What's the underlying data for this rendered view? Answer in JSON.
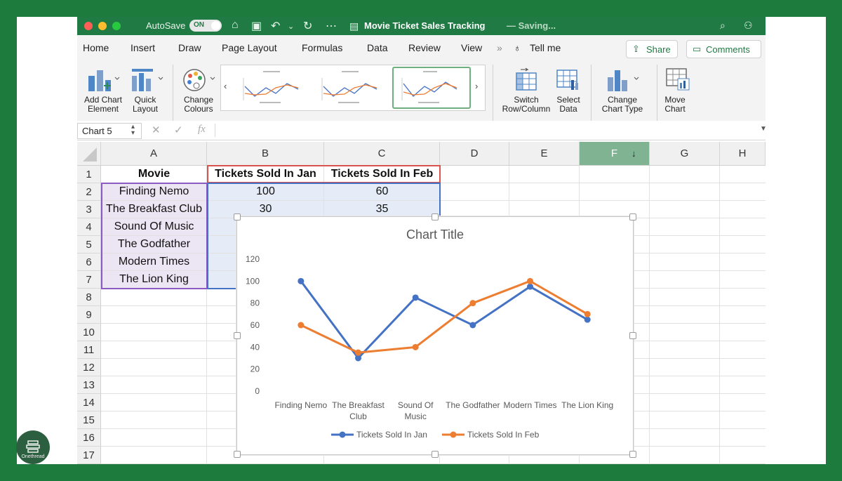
{
  "window": {
    "autosave_label": "AutoSave",
    "autosave_state": "ON",
    "title": "Movie Ticket Sales Tracking",
    "saving_status": "— Saving..."
  },
  "menu": {
    "items": [
      "Home",
      "Insert",
      "Draw",
      "Page Layout",
      "Formulas",
      "Data",
      "Review",
      "View"
    ],
    "tell_me": "Tell me",
    "share_label": "Share",
    "comments_label": "Comments"
  },
  "ribbon": {
    "add_chart_element": [
      "Add Chart",
      "Element"
    ],
    "quick_layout": [
      "Quick",
      "Layout"
    ],
    "change_colours": [
      "Change",
      "Colours"
    ],
    "switch_row_column": [
      "Switch",
      "Row/Column"
    ],
    "select_data": [
      "Select",
      "Data"
    ],
    "change_chart_type": [
      "Change",
      "Chart Type"
    ],
    "move_chart": [
      "Move",
      "Chart"
    ]
  },
  "formula_bar": {
    "name_box": "Chart 5",
    "fx_label": "fx"
  },
  "sheet": {
    "columns": [
      "A",
      "B",
      "C",
      "D",
      "E",
      "F",
      "G",
      "H"
    ],
    "rows": [
      "1",
      "2",
      "3",
      "4",
      "5",
      "6",
      "7",
      "8",
      "9",
      "10",
      "11",
      "12",
      "13",
      "14",
      "15",
      "16",
      "17"
    ],
    "headers": [
      "Movie",
      "Tickets Sold In Jan",
      "Tickets Sold In Feb"
    ],
    "movies": [
      "Finding Nemo",
      "The Breakfast Club",
      "Sound Of Music",
      "The Godfather",
      "Modern Times",
      "The Lion King"
    ],
    "jan_visible": [
      "100",
      "30"
    ],
    "feb_visible": [
      "60",
      "35"
    ]
  },
  "chart_data": {
    "type": "line",
    "title": "Chart Title",
    "categories": [
      "Finding Nemo",
      "The Breakfast Club",
      "Sound Of Music",
      "The Godfather",
      "Modern Times",
      "The Lion King"
    ],
    "series": [
      {
        "name": "Tickets Sold In Jan",
        "values": [
          100,
          30,
          85,
          60,
          95,
          65
        ],
        "color": "#4472c4"
      },
      {
        "name": "Tickets Sold In Feb",
        "values": [
          60,
          35,
          40,
          80,
          100,
          70
        ],
        "color": "#ed7d31"
      }
    ],
    "yticks": [
      0,
      20,
      40,
      60,
      80,
      100,
      120
    ],
    "ylim": [
      0,
      120
    ],
    "legend_position": "bottom",
    "grid": false
  },
  "brand": {
    "name": "Onethread"
  }
}
